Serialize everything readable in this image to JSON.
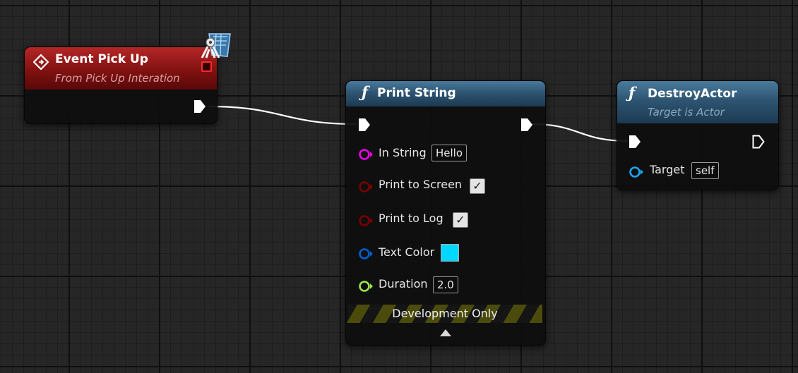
{
  "colors": {
    "event_header": "#8f1515",
    "function_header": "#2e5572",
    "string_pin": "#ee00ee",
    "bool_pin": "#7a0000",
    "struct_pin": "#0060d0",
    "float_pin": "#9de64a",
    "object_pin": "#1ca6f0",
    "text_color_value": "#00d8ff"
  },
  "event_node": {
    "icon": "event-diamond-icon",
    "title": "Event Pick Up",
    "subtitle": "From Pick Up Interation",
    "badge_icon": "interface-gears-icon"
  },
  "print_string": {
    "icon": "function-icon",
    "title": "Print String",
    "pins": {
      "in_string": {
        "label": "In String",
        "value": "Hello"
      },
      "print_to_screen": {
        "label": "Print to Screen",
        "checked": true
      },
      "print_to_log": {
        "label": "Print to Log",
        "checked": true
      },
      "text_color": {
        "label": "Text Color"
      },
      "duration": {
        "label": "Duration",
        "value": "2.0"
      }
    },
    "dev_label": "Development Only",
    "expand_icon": "expand-arrow-icon"
  },
  "destroy_actor": {
    "icon": "function-icon",
    "title": "DestroyActor",
    "subtitle": "Target is Actor",
    "pins": {
      "target": {
        "label": "Target",
        "value": "self"
      }
    }
  }
}
